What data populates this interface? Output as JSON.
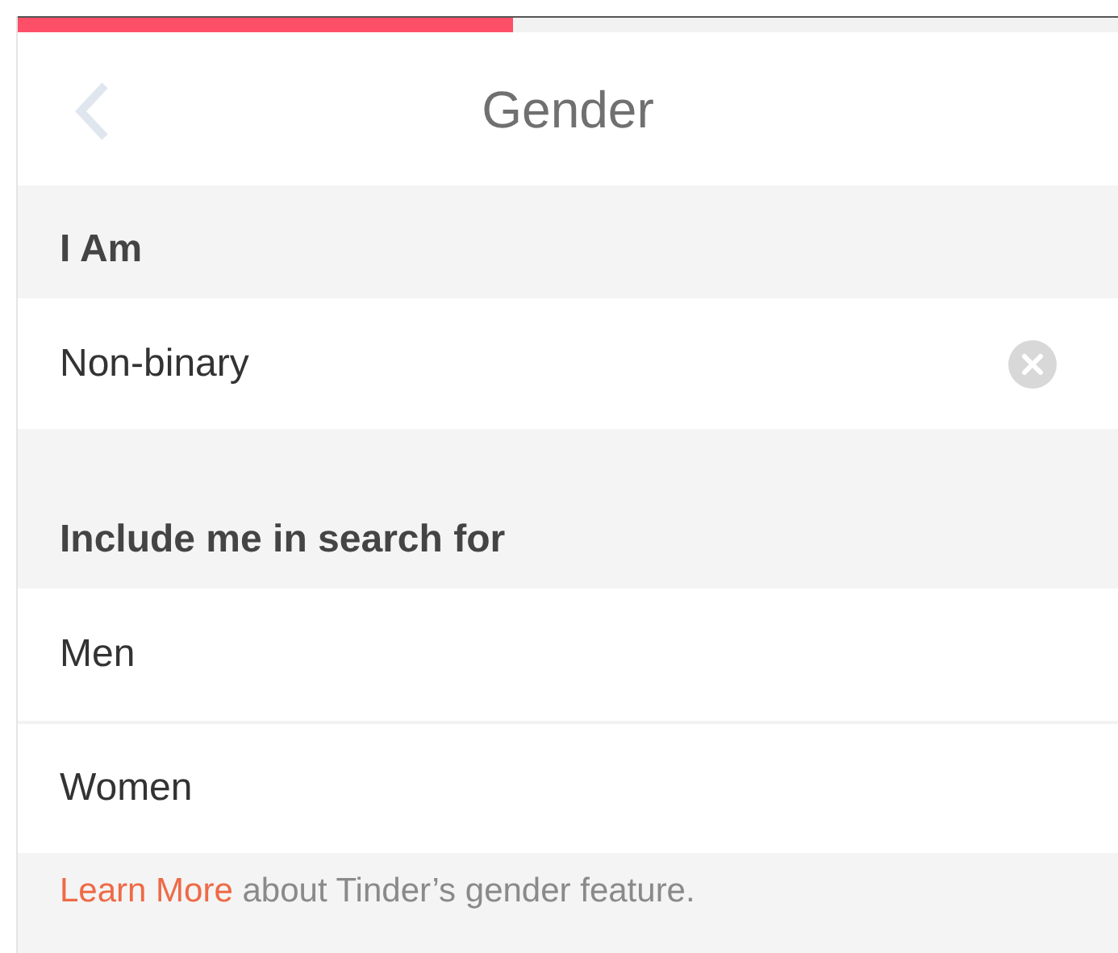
{
  "progress": {
    "level": 0.45
  },
  "header": {
    "title": "Gender"
  },
  "identity": {
    "heading": "I Am",
    "value": "Non-binary"
  },
  "search_for": {
    "heading": "Include me in search for",
    "options": [
      {
        "label": "Men"
      },
      {
        "label": "Women"
      }
    ]
  },
  "footer": {
    "link": "Learn More",
    "text": "about Tinder’s gender feature."
  }
}
